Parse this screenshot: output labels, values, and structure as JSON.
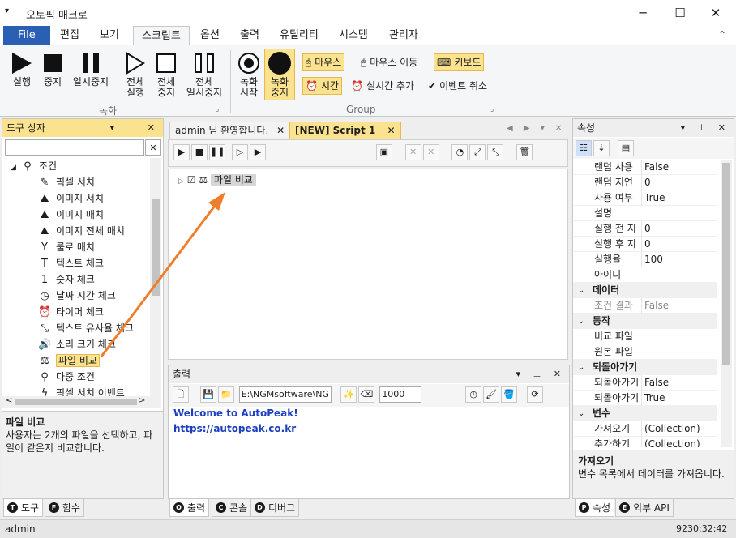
{
  "titlebar": {
    "menu_glyph": "▾",
    "title": "오토픽 매크로",
    "minimize": "─",
    "maximize": "☐",
    "close": "✕"
  },
  "ribbon_tabs": [
    "File",
    "편집",
    "보기",
    "스크립트",
    "옵션",
    "출력",
    "유틸리티",
    "시스템",
    "관리자"
  ],
  "ribbon_collapse": "⌃",
  "ribbon": {
    "run": "실행",
    "stop": "중지",
    "pause": "일시중지",
    "all_run": "전체\n실행",
    "all_stop": "전체\n중지",
    "all_pause": "전체\n일시중지",
    "rec_start": "녹화\n시작",
    "rec_stop": "녹화\n중지",
    "mouse": "마우스",
    "mouse_move": "마우스 이동",
    "keyboard": "키보드",
    "time": "시간",
    "realtime_add": "실시간 추가",
    "event_cancel": "이벤트 취소",
    "group_rec": "녹화",
    "group_group": "Group",
    "launcher": "⌟"
  },
  "toolbox": {
    "header": "도구 상자",
    "header_btns": "▾ ⊥ ✕",
    "search_value": "",
    "clear": "✕",
    "category": "조건",
    "items": [
      "픽셀 서치",
      "이미지 서치",
      "이미지 매치",
      "이미지 전체 매치",
      "룰로 매치",
      "텍스트 체크",
      "숫자 체크",
      "날짜 시간 체크",
      "타이머 체크",
      "텍스트 유사율 체크",
      "소리 크기 체크",
      "파일 비교",
      "다중 조건",
      "픽셀 서치 이벤트"
    ],
    "item_icons": [
      "✎",
      "⛰",
      "⛰",
      "⛰",
      "Y",
      "T",
      "1",
      "◷",
      "⏰",
      "⤡",
      "🔊",
      "⚖",
      "⚲",
      "ϟ"
    ],
    "desc_title": "파일 비교",
    "desc_text": "사용자는 2개의 파일을 선택하고, 파일이 같은지 비교합니다.",
    "tabs": [
      {
        "icon": "T",
        "label": "도구"
      },
      {
        "icon": "F",
        "label": "함수"
      }
    ]
  },
  "documents": {
    "tabs": [
      "admin 님 환영합니다.",
      "[NEW] Script 1"
    ],
    "tab_close": "✕",
    "nav": "◀ ▶ ▾ ✕",
    "tree_node": "파일 비교",
    "check": "☑"
  },
  "output": {
    "header": "출력",
    "header_btns": "▾ ⊥ ✕",
    "path": "E:\\NGMsoftware\\NG",
    "number": "1000",
    "line1": "Welcome to AutoPeak!",
    "line2": "https://autopeak.co.kr",
    "tabs": [
      {
        "icon": "O",
        "label": "출력"
      },
      {
        "icon": "C",
        "label": "콘솔"
      },
      {
        "icon": "D",
        "label": "디버그"
      }
    ]
  },
  "properties": {
    "header": "속성",
    "header_btns": "▾ ⊥ ✕",
    "rows": [
      {
        "k": "랜덤 사용",
        "v": "False"
      },
      {
        "k": "랜덤 지연",
        "v": "0"
      },
      {
        "k": "사용 여부",
        "v": "True"
      },
      {
        "k": "설명",
        "v": ""
      },
      {
        "k": "실행 전 지",
        "v": "0"
      },
      {
        "k": "실행 후 지",
        "v": "0"
      },
      {
        "k": "실행율",
        "v": "100"
      },
      {
        "k": "아이디",
        "v": ""
      }
    ],
    "cat_data": "데이터",
    "row_data": {
      "k": "조건 결과",
      "v": "False"
    },
    "cat_action": "동작",
    "rows_action": [
      {
        "k": "비교 파일",
        "v": ""
      },
      {
        "k": "원본 파일",
        "v": ""
      }
    ],
    "cat_return": "되돌아가기",
    "rows_return": [
      {
        "k": "되돌아가기",
        "v": "False"
      },
      {
        "k": "되돌아가기",
        "v": "True"
      }
    ],
    "cat_var": "변수",
    "rows_var": [
      {
        "k": "가져오기",
        "v": "(Collection)"
      },
      {
        "k": "추가하기",
        "v": "(Collection)"
      }
    ],
    "desc_title": "가져오기",
    "desc_text": "변수 목록에서 데이터를 가져옵니다.",
    "tabs": [
      {
        "icon": "P",
        "label": "속성"
      },
      {
        "icon": "E",
        "label": "외부 API"
      }
    ]
  },
  "statusbar": {
    "user": "admin",
    "clock": "9230:32:42"
  },
  "colors": {
    "accent": "#2b5fb4",
    "highlight": "#fbe28e",
    "arrow": "#f07d2a"
  }
}
